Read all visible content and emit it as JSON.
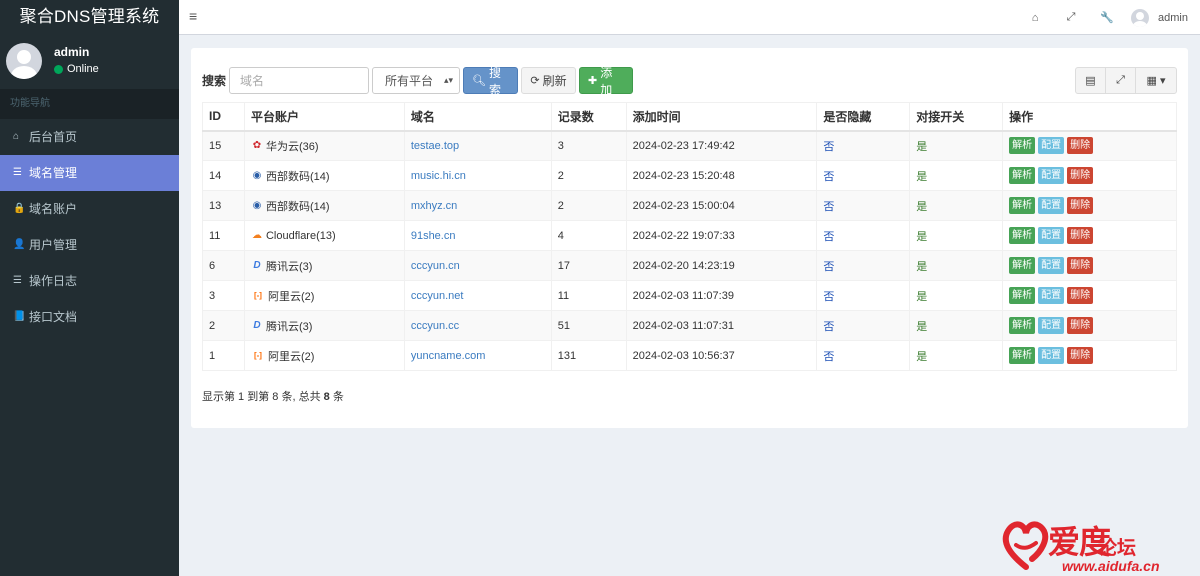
{
  "app": {
    "title": "聚合DNS管理系统"
  },
  "user": {
    "name": "admin",
    "status": "Online"
  },
  "sidebar": {
    "header": "功能导航",
    "items": [
      {
        "label": "后台首页",
        "icon": "home-icon",
        "glyph": "⌂"
      },
      {
        "label": "域名管理",
        "icon": "list-icon",
        "glyph": "☰",
        "active": true
      },
      {
        "label": "域名账户",
        "icon": "lock-icon",
        "glyph": "🔒"
      },
      {
        "label": "用户管理",
        "icon": "user-icon",
        "glyph": "👤"
      },
      {
        "label": "操作日志",
        "icon": "list-icon",
        "glyph": "☰"
      },
      {
        "label": "接口文档",
        "icon": "book-icon",
        "glyph": "📘"
      }
    ]
  },
  "topbar": {
    "menu_glyph": "≡",
    "username": "admin"
  },
  "toolbar": {
    "search_label": "搜索",
    "search_placeholder": "域名",
    "platform_select": "所有平台",
    "search_button": "搜索",
    "refresh_button": "刷新",
    "add_button": "添加"
  },
  "table": {
    "columns": [
      "ID",
      "平台账户",
      "域名",
      "记录数",
      "添加时间",
      "是否隐藏",
      "对接开关",
      "操作"
    ],
    "rows": [
      {
        "id": "15",
        "platform": "华为云(36)",
        "platform_icon": "huawei-icon",
        "domain": "testae.top",
        "records": "3",
        "time": "2024-02-23 17:49:42",
        "hidden": "否",
        "enabled": "是"
      },
      {
        "id": "14",
        "platform": "西部数码(14)",
        "platform_icon": "west-icon",
        "domain": "music.hi.cn",
        "records": "2",
        "time": "2024-02-23 15:20:48",
        "hidden": "否",
        "enabled": "是"
      },
      {
        "id": "13",
        "platform": "西部数码(14)",
        "platform_icon": "west-icon",
        "domain": "mxhyz.cn",
        "records": "2",
        "time": "2024-02-23 15:00:04",
        "hidden": "否",
        "enabled": "是"
      },
      {
        "id": "11",
        "platform": "Cloudflare(13)",
        "platform_icon": "cloudflare-icon",
        "domain": "91she.cn",
        "records": "4",
        "time": "2024-02-22 19:07:33",
        "hidden": "否",
        "enabled": "是"
      },
      {
        "id": "6",
        "platform": "腾讯云(3)",
        "platform_icon": "dnspod-icon",
        "domain": "cccyun.cn",
        "records": "17",
        "time": "2024-02-20 14:23:19",
        "hidden": "否",
        "enabled": "是"
      },
      {
        "id": "3",
        "platform": "阿里云(2)",
        "platform_icon": "aliyun-icon",
        "domain": "cccyun.net",
        "records": "11",
        "time": "2024-02-03 11:07:39",
        "hidden": "否",
        "enabled": "是"
      },
      {
        "id": "2",
        "platform": "腾讯云(3)",
        "platform_icon": "dnspod-icon",
        "domain": "cccyun.cc",
        "records": "51",
        "time": "2024-02-03 11:07:31",
        "hidden": "否",
        "enabled": "是"
      },
      {
        "id": "1",
        "platform": "阿里云(2)",
        "platform_icon": "aliyun-icon",
        "domain": "yuncname.com",
        "records": "131",
        "time": "2024-02-03 10:56:37",
        "hidden": "否",
        "enabled": "是"
      }
    ],
    "actions": {
      "resolve": "解析",
      "config": "配置",
      "delete": "删除"
    }
  },
  "pager": {
    "prefix": "显示第 1 到第 8 条, 总共 ",
    "total": "8",
    "suffix": " 条"
  },
  "watermark": {
    "title": "爱度",
    "sub": "论坛",
    "url": "www.aidufa.cn"
  },
  "colors": {
    "sidebar_bg": "#222d32",
    "active_nav": "#6b7fd7",
    "primary": "#6593c9",
    "success": "#4fad5b",
    "danger": "#cc4632",
    "info": "#6cbfdf"
  }
}
